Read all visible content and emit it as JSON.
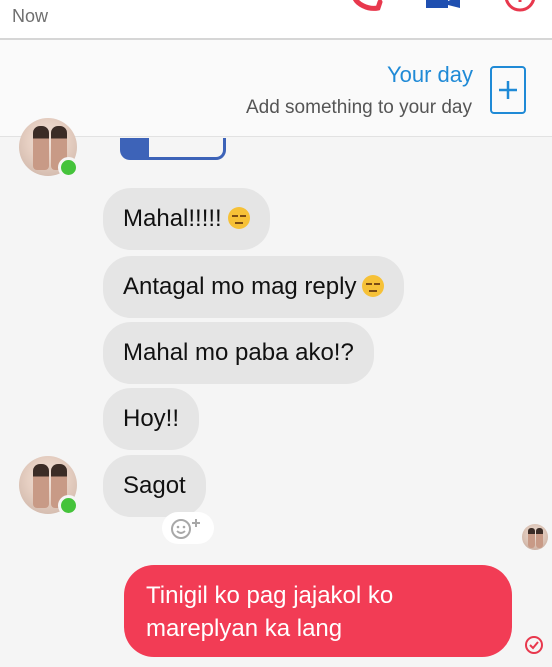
{
  "header": {
    "time_label": "Now",
    "icons": [
      "phone-icon",
      "video-icon",
      "info-icon"
    ],
    "accent_color": "#e8384d"
  },
  "your_day": {
    "title": "Your day",
    "subtitle": "Add something to your day",
    "add_icon": "plus-icon",
    "accent_color": "#1f8ad6"
  },
  "messages": {
    "received": [
      {
        "text": "Mahal!!!!!",
        "emoji": "unamused-emoji"
      },
      {
        "text": "Antagal mo mag reply",
        "emoji": "pensive-emoji"
      },
      {
        "text": "Mahal mo paba ako!?"
      },
      {
        "text": "Hoy!!"
      },
      {
        "text": "Sagot"
      }
    ],
    "reaction_button": "add-reaction-icon",
    "sent": {
      "lines": [
        "Tinigil ko pag jajakol ko",
        "mareplyan ka lang"
      ],
      "color": "#f23c55",
      "status_icon": "delivered-check-icon"
    }
  },
  "colors": {
    "received_bubble": "#e5e5e5",
    "online_dot": "#45c33b"
  }
}
